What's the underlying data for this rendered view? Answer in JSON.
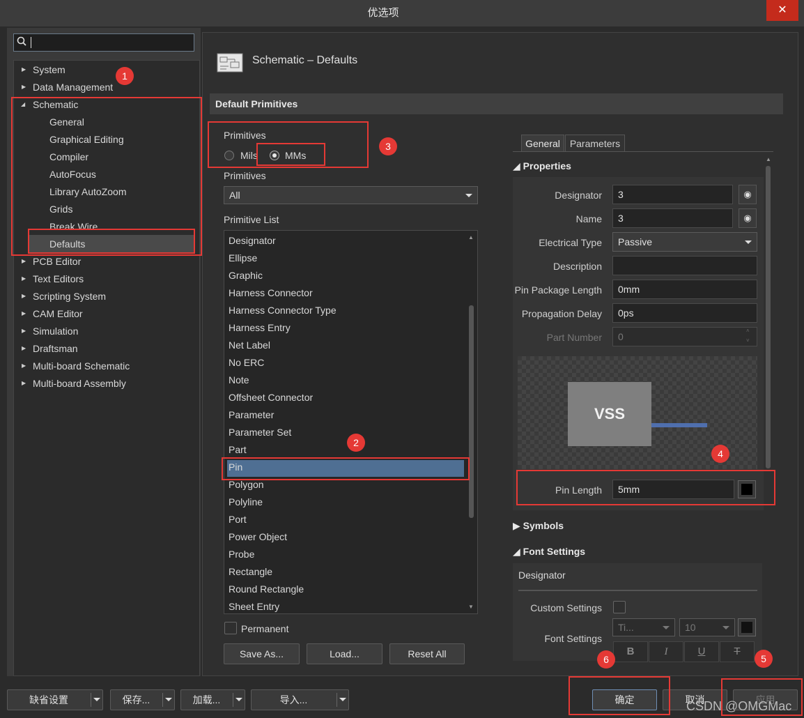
{
  "window": {
    "title": "优选项",
    "close_glyph": "✕"
  },
  "search": {
    "icon": "search-icon",
    "glyph": "🔍",
    "placeholder": ""
  },
  "tree": {
    "items": [
      {
        "label": "System",
        "arrow": "▶"
      },
      {
        "label": "Data Management",
        "arrow": "▶"
      },
      {
        "label": "Schematic",
        "arrow": "◢"
      },
      {
        "label": "General"
      },
      {
        "label": "Graphical Editing"
      },
      {
        "label": "Compiler"
      },
      {
        "label": "AutoFocus"
      },
      {
        "label": "Library AutoZoom"
      },
      {
        "label": "Grids"
      },
      {
        "label": "Break Wire"
      },
      {
        "label": "Defaults"
      },
      {
        "label": "PCB Editor",
        "arrow": "▶"
      },
      {
        "label": "Text Editors",
        "arrow": "▶"
      },
      {
        "label": "Scripting System",
        "arrow": "▶"
      },
      {
        "label": "CAM Editor",
        "arrow": "▶"
      },
      {
        "label": "Simulation",
        "arrow": "▶"
      },
      {
        "label": "Draftsman",
        "arrow": "▶"
      },
      {
        "label": "Multi-board Schematic",
        "arrow": "▶"
      },
      {
        "label": "Multi-board Assembly",
        "arrow": "▶"
      }
    ],
    "selected": "Defaults"
  },
  "page": {
    "title": "Schematic – Defaults",
    "section": "Default Primitives"
  },
  "units": {
    "label": "Primitives",
    "option1": "Mils",
    "option2": "MMs",
    "selected": "MMs"
  },
  "primitives_filter": {
    "label": "Primitives",
    "value": "All"
  },
  "primitive_list": {
    "label": "Primitive List",
    "items": [
      "Designator",
      "Ellipse",
      "Graphic",
      "Harness Connector",
      "Harness Connector Type",
      "Harness Entry",
      "Net Label",
      "No ERC",
      "Note",
      "Offsheet Connector",
      "Parameter",
      "Parameter Set",
      "Part",
      "Pin",
      "Polygon",
      "Polyline",
      "Port",
      "Power Object",
      "Probe",
      "Rectangle",
      "Round Rectangle",
      "Sheet Entry"
    ],
    "selected": "Pin"
  },
  "permanent": {
    "label": "Permanent",
    "checked": false
  },
  "buttons": {
    "save_as": "Save As...",
    "load": "Load...",
    "reset_all": "Reset All"
  },
  "tabs": {
    "general": "General",
    "parameters": "Parameters"
  },
  "properties": {
    "header": "Properties",
    "designator": {
      "label": "Designator",
      "value": "3"
    },
    "name": {
      "label": "Name",
      "value": "3"
    },
    "electrical_type": {
      "label": "Electrical Type",
      "value": "Passive"
    },
    "description": {
      "label": "Description",
      "value": ""
    },
    "pin_package_length": {
      "label": "Pin Package Length",
      "value": "0mm"
    },
    "propagation_delay": {
      "label": "Propagation Delay",
      "value": "0ps"
    },
    "part_number": {
      "label": "Part Number",
      "value": "0"
    },
    "preview_text": "VSS",
    "pin_length": {
      "label": "Pin Length",
      "value": "5mm"
    },
    "eye_glyph": "◉"
  },
  "symbols": {
    "header": "Symbols"
  },
  "font_settings": {
    "header": "Font Settings",
    "designator": "Designator",
    "custom_settings": "Custom Settings",
    "font_settings": "Font Settings",
    "font_value": "Ti...",
    "size_value": "10",
    "bold": "B",
    "italic": "I",
    "underline": "U",
    "strike": "T"
  },
  "bottom": {
    "defaults": "缺省设置",
    "save": "保存...",
    "load": "加载...",
    "import": "导入...",
    "ok": "确定",
    "cancel": "取消",
    "apply": "应用"
  },
  "badges": [
    "1",
    "2",
    "3",
    "4",
    "5",
    "6"
  ],
  "watermark": "CSDN @OMGMac",
  "colors": {
    "accent_red": "#e53935",
    "selection": "#4f6f93",
    "pin_line": "#4f6fae"
  }
}
